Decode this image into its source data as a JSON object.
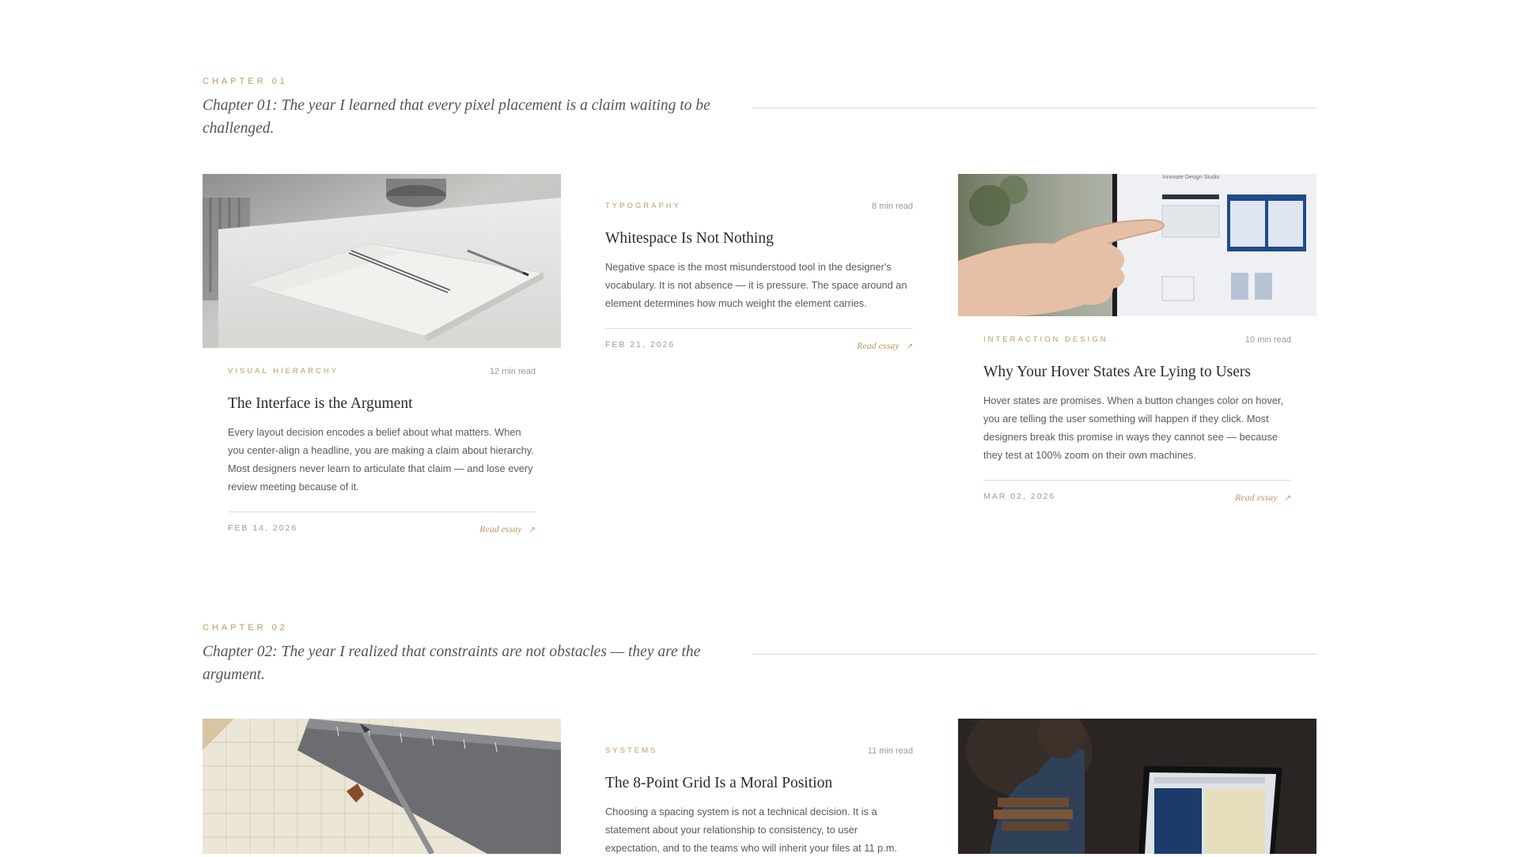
{
  "chapters": [
    {
      "label": "CHAPTER 01",
      "title": "Chapter 01: The year I learned that every pixel placement is a claim waiting to be challenged.",
      "cards": [
        {
          "image": "notebook-photo",
          "category": "VISUAL HIERARCHY",
          "read_time": "12 min read",
          "title": "The Interface is the Argument",
          "excerpt": "Every layout decision encodes a belief about what matters. When you center-align a headline, you are making a claim about hierarchy. Most designers never learn to articulate that claim — and lose every review meeting because of it.",
          "date": "FEB 14, 2026",
          "link": "Read essay"
        },
        {
          "image": "",
          "category": "TYPOGRAPHY",
          "read_time": "8 min read",
          "title": "Whitespace Is Not Nothing",
          "excerpt": "Negative space is the most misunderstood tool in the designer's vocabulary. It is not absence — it is pressure. The space around an element determines how much weight the element carries.",
          "date": "FEB 21, 2026",
          "link": "Read essay"
        },
        {
          "image": "hand-pointing-screen-photo",
          "category": "INTERACTION DESIGN",
          "read_time": "10 min read",
          "title": "Why Your Hover States Are Lying to Users",
          "excerpt": "Hover states are promises. When a button changes color on hover, you are telling the user something will happen if they click. Most designers break this promise in ways they cannot see — because they test at 100% zoom on their own machines.",
          "date": "MAR 02, 2026",
          "link": "Read essay"
        }
      ]
    },
    {
      "label": "CHAPTER 02",
      "title": "Chapter 02: The year I realized that constraints are not obstacles — they are the argument.",
      "cards": [
        {
          "image": "ruler-pencil-photo",
          "category": "",
          "read_time": "",
          "title": "",
          "excerpt": "",
          "date": "",
          "link": ""
        },
        {
          "image": "",
          "category": "SYSTEMS",
          "read_time": "11 min read",
          "title": "The 8-Point Grid Is a Moral Position",
          "excerpt": "Choosing a spacing system is not a technical decision. It is a statement about your relationship to consistency, to user expectation, and to the teams who will inherit your files at 11 p.m.",
          "date": "",
          "link": ""
        },
        {
          "image": "laptop-dark-photo",
          "category": "",
          "read_time": "",
          "title": "",
          "excerpt": "",
          "date": "",
          "link": ""
        }
      ]
    }
  ],
  "image_texts": {
    "screen_header": "Innovate Design Studio"
  },
  "colors": {
    "accent": "#b89a63",
    "rule": "#d8d8d8",
    "text": "#2b2b2b",
    "muted": "#9a9a9a"
  }
}
